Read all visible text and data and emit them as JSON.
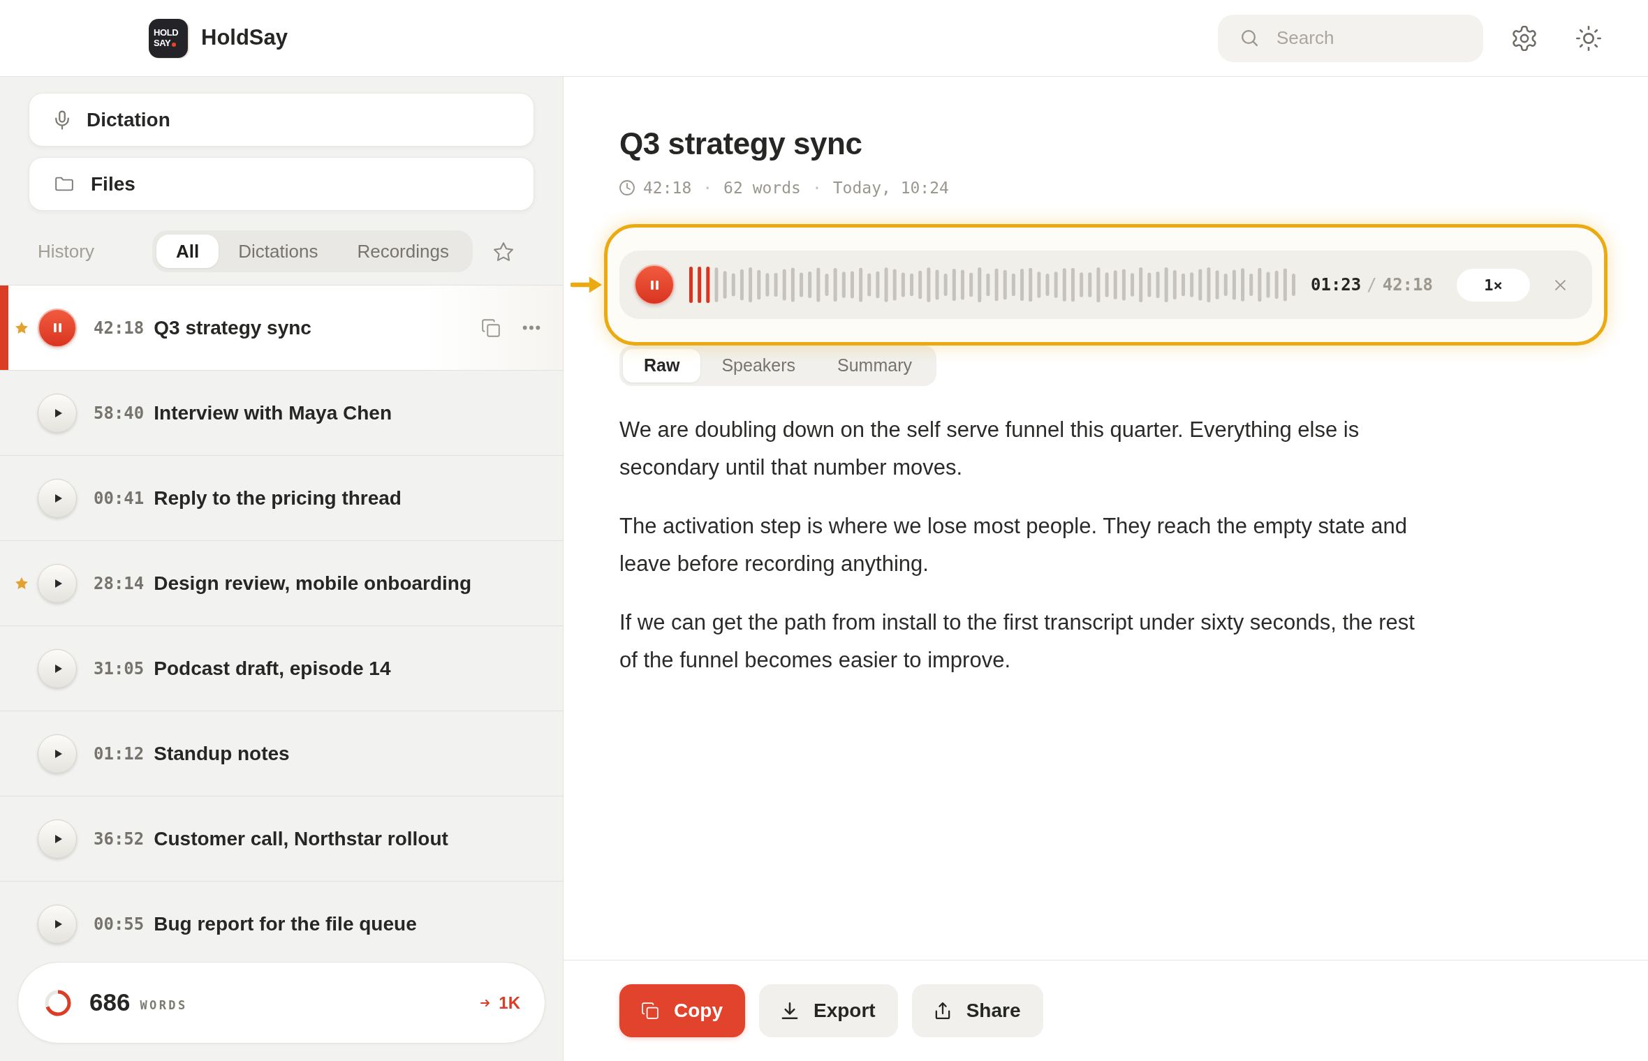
{
  "header": {
    "logo_lines": [
      "HOLD",
      "SAY"
    ],
    "app_name": "HoldSay",
    "search": {
      "placeholder": "Search"
    }
  },
  "sidebar": {
    "nav": [
      {
        "kind": "mic",
        "label": "Dictation"
      },
      {
        "kind": "folder",
        "label": "Files"
      }
    ],
    "history_label": "History",
    "filters": [
      {
        "label": "All",
        "selected": true
      },
      {
        "label": "Dictations",
        "selected": false
      },
      {
        "label": "Recordings",
        "selected": false
      }
    ],
    "items": [
      {
        "time": "42:18",
        "title": "Q3 strategy sync",
        "starred": true,
        "selected": true,
        "playing": true
      },
      {
        "time": "58:40",
        "title": "Interview with Maya Chen",
        "starred": false,
        "selected": false,
        "playing": false
      },
      {
        "time": "00:41",
        "title": "Reply to the pricing thread",
        "starred": false,
        "selected": false,
        "playing": false
      },
      {
        "time": "28:14",
        "title": "Design review, mobile onboarding",
        "starred": true,
        "selected": false,
        "playing": false
      },
      {
        "time": "31:05",
        "title": "Podcast draft, episode 14",
        "starred": false,
        "selected": false,
        "playing": false
      },
      {
        "time": "01:12",
        "title": "Standup notes",
        "starred": false,
        "selected": false,
        "playing": false
      },
      {
        "time": "36:52",
        "title": "Customer call, Northstar rollout",
        "starred": false,
        "selected": false,
        "playing": false
      },
      {
        "time": "00:55",
        "title": "Bug report for the file queue",
        "starred": false,
        "selected": false,
        "playing": false
      }
    ],
    "word_goal": {
      "count": "686",
      "unit": "WORDS",
      "goal": "1K",
      "level": 0.69
    }
  },
  "document": {
    "title": "Q3 strategy sync",
    "meta": [
      {
        "kind": "duration",
        "text": "42:18"
      },
      {
        "kind": "separator",
        "text": "·"
      },
      {
        "kind": "words",
        "text": "62 words"
      },
      {
        "kind": "separator",
        "text": "·"
      },
      {
        "kind": "date",
        "text": "Today, 10:24"
      }
    ],
    "player": {
      "highlighted": true,
      "playing": true,
      "level": 0.04,
      "current": "01:23",
      "separator": "/",
      "total": "42:18",
      "speed": "1×"
    },
    "tabs": [
      {
        "label": "Raw",
        "selected": true
      },
      {
        "label": "Speakers",
        "selected": false
      },
      {
        "label": "Summary",
        "selected": false
      }
    ],
    "paragraphs": [
      "We are doubling down on the self serve funnel this quarter. Everything else is secondary until that number moves.",
      "The activation step is where we lose most people. They reach the empty state and leave before recording anything.",
      "If we can get the path from install to the first transcript under sixty seconds, the rest of the funnel becomes easier to improve."
    ],
    "actions": [
      {
        "kind": "copy",
        "label": "Copy",
        "primary": true
      },
      {
        "kind": "export",
        "label": "Export",
        "primary": false
      },
      {
        "kind": "share",
        "label": "Share",
        "primary": false
      }
    ]
  }
}
